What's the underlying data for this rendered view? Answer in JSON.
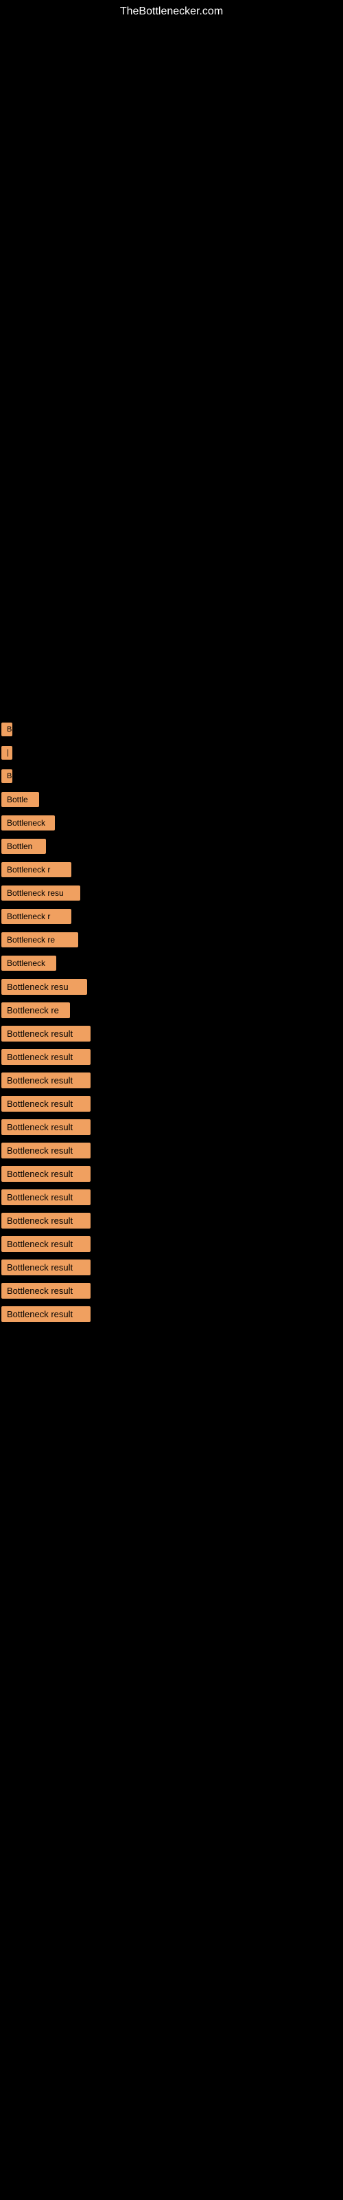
{
  "header": {
    "title": "TheBottlenecker.com"
  },
  "items": [
    {
      "id": 1,
      "label": "B",
      "class": "item-1"
    },
    {
      "id": 2,
      "label": "|",
      "class": "item-2"
    },
    {
      "id": 3,
      "label": "B",
      "class": "item-3"
    },
    {
      "id": 4,
      "label": "Bottle",
      "class": "item-4"
    },
    {
      "id": 5,
      "label": "Bottleneck",
      "class": "item-5"
    },
    {
      "id": 6,
      "label": "Bottlen",
      "class": "item-6"
    },
    {
      "id": 7,
      "label": "Bottleneck r",
      "class": "item-7"
    },
    {
      "id": 8,
      "label": "Bottleneck resu",
      "class": "item-8"
    },
    {
      "id": 9,
      "label": "Bottleneck r",
      "class": "item-9"
    },
    {
      "id": 10,
      "label": "Bottleneck re",
      "class": "item-10"
    },
    {
      "id": 11,
      "label": "Bottleneck",
      "class": "item-11"
    },
    {
      "id": 12,
      "label": "Bottleneck resu",
      "class": "item-12"
    },
    {
      "id": 13,
      "label": "Bottleneck re",
      "class": "item-13"
    },
    {
      "id": 14,
      "label": "Bottleneck result",
      "class": "item-14"
    },
    {
      "id": 15,
      "label": "Bottleneck result",
      "class": "item-15"
    },
    {
      "id": 16,
      "label": "Bottleneck result",
      "class": "item-16"
    },
    {
      "id": 17,
      "label": "Bottleneck result",
      "class": "item-17"
    },
    {
      "id": 18,
      "label": "Bottleneck result",
      "class": "item-18"
    },
    {
      "id": 19,
      "label": "Bottleneck result",
      "class": "item-19"
    },
    {
      "id": 20,
      "label": "Bottleneck result",
      "class": "item-20"
    },
    {
      "id": 21,
      "label": "Bottleneck result",
      "class": "item-21"
    },
    {
      "id": 22,
      "label": "Bottleneck result",
      "class": "item-22"
    },
    {
      "id": 23,
      "label": "Bottleneck result",
      "class": "item-23"
    },
    {
      "id": 24,
      "label": "Bottleneck result",
      "class": "item-24"
    },
    {
      "id": 25,
      "label": "Bottleneck result",
      "class": "item-25"
    },
    {
      "id": 26,
      "label": "Bottleneck result",
      "class": "item-26"
    }
  ]
}
